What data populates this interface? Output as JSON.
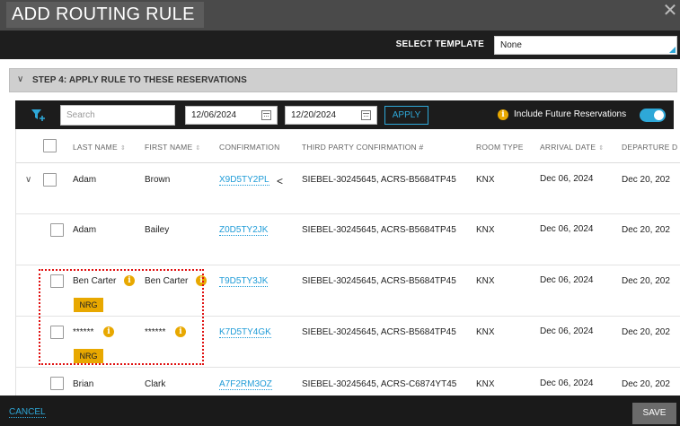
{
  "dialog": {
    "title": "ADD ROUTING RULE"
  },
  "template": {
    "label": "SELECT TEMPLATE",
    "value": "None"
  },
  "step": {
    "label": "STEP 4: APPLY RULE TO THESE RESERVATIONS"
  },
  "toolbar": {
    "search_placeholder": "Search",
    "start_date": "12/06/2024",
    "end_date": "12/20/2024",
    "apply_label": "APPLY",
    "future_label": "Include Future Reservations",
    "future_enabled": true
  },
  "columns": {
    "last_name": "LAST NAME",
    "first_name": "FIRST NAME",
    "confirmation": "CONFIRMATION",
    "third_party": "THIRD PARTY CONFIRMATION #",
    "room_type": "ROOM TYPE",
    "arrival": "ARRIVAL DATE",
    "departure": "DEPARTURE D"
  },
  "rows": [
    {
      "last": "Adam",
      "first": "Brown",
      "conf": "X9D5TY2PL",
      "third": "SIEBEL-30245645, ACRS-B5684TP45",
      "room": "KNX",
      "arrival": "Dec 06, 2024",
      "departure": "Dec 20, 202"
    },
    {
      "last": "Adam",
      "first": "Bailey",
      "conf": "Z0D5TY2JK",
      "third": "SIEBEL-30245645, ACRS-B5684TP45",
      "room": "KNX",
      "arrival": "Dec 06, 2024",
      "departure": "Dec 20, 202"
    },
    {
      "last": "Ben Carter",
      "first": "Ben Carter",
      "conf": "T9D5TY3JK",
      "third": "SIEBEL-30245645, ACRS-B5684TP45",
      "room": "KNX",
      "arrival": "Dec 06, 2024",
      "departure": "Dec 20, 202",
      "badge": "NRG"
    },
    {
      "last": "******",
      "first": "******",
      "conf": "K7D5TY4GK",
      "third": "SIEBEL-30245645, ACRS-B5684TP45",
      "room": "KNX",
      "arrival": "Dec 06, 2024",
      "departure": "Dec 20, 202",
      "badge": "NRG"
    },
    {
      "last": "Brian",
      "first": "Clark",
      "conf": "A7F2RM3OZ",
      "third": "SIEBEL-30245645, ACRS-C6874YT45",
      "room": "KNX",
      "arrival": "Dec 06, 2024",
      "departure": "Dec 20, 202"
    }
  ],
  "footer": {
    "cancel_label": "CANCEL",
    "save_label": "SAVE"
  },
  "colors": {
    "accent": "#2ea8d8",
    "badge": "#e8a800",
    "highlight": "#e01010"
  },
  "icons": {
    "filter": "filter-plus-icon",
    "close": "close-icon",
    "calendar": "calendar-icon",
    "info": "info-icon",
    "share": "share-icon",
    "expand": "chevron-down-icon"
  }
}
